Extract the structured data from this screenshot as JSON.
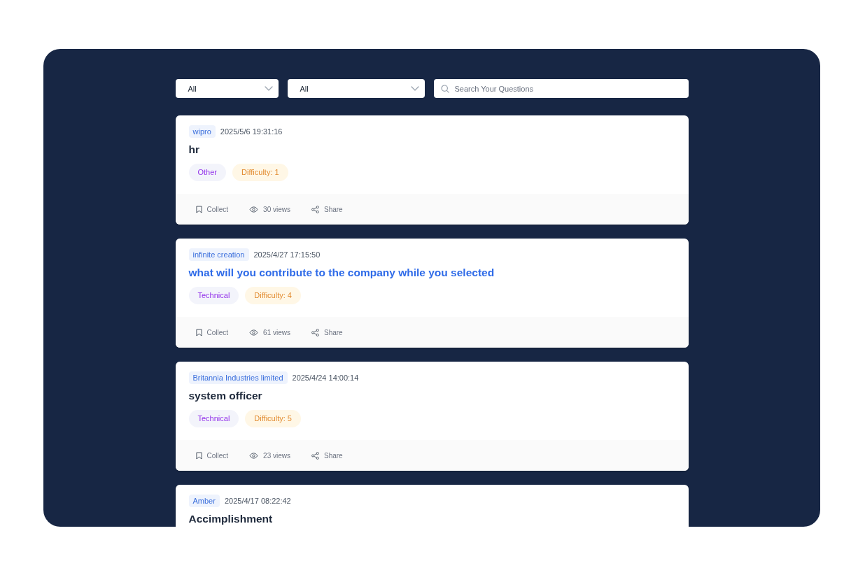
{
  "filters": {
    "selects": [
      {
        "value": "All"
      },
      {
        "value": "All"
      }
    ],
    "search": {
      "placeholder": "Search Your Questions"
    }
  },
  "questions": [
    {
      "company": "wipro",
      "date": "2025/5/6 19:31:16",
      "title": "hr",
      "highlighted": false,
      "tags": [
        {
          "kind": "category",
          "label": "Other"
        },
        {
          "kind": "difficulty",
          "label": "Difficulty: 1"
        }
      ],
      "actions": [
        {
          "kind": "collect",
          "label": "Collect"
        },
        {
          "kind": "views",
          "label": "30 views"
        },
        {
          "kind": "share",
          "label": "Share"
        }
      ]
    },
    {
      "company": "infinite creation",
      "date": "2025/4/27 17:15:50",
      "title": "what will you contribute to the company while you selected",
      "highlighted": true,
      "tags": [
        {
          "kind": "category",
          "label": "Technical"
        },
        {
          "kind": "difficulty",
          "label": "Difficulty: 4"
        }
      ],
      "actions": [
        {
          "kind": "collect",
          "label": "Collect"
        },
        {
          "kind": "views",
          "label": "61 views"
        },
        {
          "kind": "share",
          "label": "Share"
        }
      ]
    },
    {
      "company": "Britannia Industries limited",
      "date": "2025/4/24 14:00:14",
      "title": "system officer",
      "highlighted": false,
      "tags": [
        {
          "kind": "category",
          "label": "Technical"
        },
        {
          "kind": "difficulty",
          "label": "Difficulty: 5"
        }
      ],
      "actions": [
        {
          "kind": "collect",
          "label": "Collect"
        },
        {
          "kind": "views",
          "label": "23 views"
        },
        {
          "kind": "share",
          "label": "Share"
        }
      ]
    },
    {
      "company": "Amber",
      "date": "2025/4/17 08:22:42",
      "title": "Accimplishment",
      "highlighted": false
    }
  ]
}
